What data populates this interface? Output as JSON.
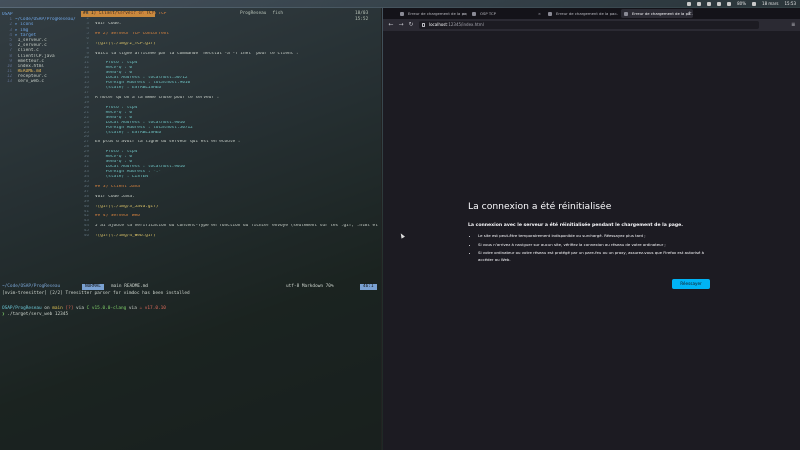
{
  "menubar": {
    "battery": "80%",
    "date": "18 mars",
    "time": "15:53"
  },
  "terminal": {
    "tree_header": "OSAP",
    "tree": [
      {
        "n": "1",
        "name": "~/Code/OSAP/ProgReseau/",
        "kind": "dir"
      },
      {
        "n": "2",
        "name": "▸ icons",
        "kind": "dir"
      },
      {
        "n": "3",
        "name": "▸ img",
        "kind": "dir"
      },
      {
        "n": "4",
        "name": "▸ target",
        "kind": "dir"
      },
      {
        "n": "5",
        "name": "  1_serveur.c",
        "kind": "file"
      },
      {
        "n": "6",
        "name": "  2_serveur.c",
        "kind": "file"
      },
      {
        "n": "7",
        "name": "  client.c",
        "kind": "file"
      },
      {
        "n": "8",
        "name": "  ClientTCP.java",
        "kind": "file"
      },
      {
        "n": "9",
        "name": "  emetteur.c",
        "kind": "file"
      },
      {
        "n": "10",
        "name": "  index.html",
        "kind": "file"
      },
      {
        "n": "11",
        "name": "  README.md",
        "kind": "mod"
      },
      {
        "n": "12",
        "name": "  recepteur.c",
        "kind": "file"
      },
      {
        "n": "13",
        "name": "  serv_web.c",
        "kind": "file"
      }
    ],
    "editor_tab": "## 1) Client/Serveur en TCP",
    "tab_rest": [
      "ProgReseau",
      "fish"
    ],
    "tab_clock": "18/03 15:52",
    "editor_lines": [
      {
        "n": "1",
        "t": "## 1) Client/Serveur en TCP",
        "c": "h"
      },
      {
        "n": "2",
        "t": "",
        "c": "plain"
      },
      {
        "n": "3",
        "t": "Voir Code.",
        "c": "plain"
      },
      {
        "n": "4",
        "t": "",
        "c": "plain"
      },
      {
        "n": "5",
        "t": "## 2) Serveur TCP Concurrent",
        "c": "h"
      },
      {
        "n": "6",
        "t": "",
        "c": "plain"
      },
      {
        "n": "7",
        "t": "![gif](./img/2_TCP.gif)",
        "c": "link"
      },
      {
        "n": "8",
        "t": "",
        "c": "plain"
      },
      {
        "n": "9",
        "t": "Voici la ligne affichée par la commande `netstat -a -f inet` pour le client :",
        "c": "plain"
      },
      {
        "n": "10",
        "t": "",
        "c": "plain"
      },
      {
        "n": "11",
        "t": "    Proto : tcp4",
        "c": "ip"
      },
      {
        "n": "12",
        "t": "    Recv-Q : 0",
        "c": "ip"
      },
      {
        "n": "13",
        "t": "    Send-Q : 0",
        "c": "ip"
      },
      {
        "n": "14",
        "t": "    Local Address : localhost.50712",
        "c": "ip"
      },
      {
        "n": "15",
        "t": "    Foreign Address : localhost.9010",
        "c": "ip"
      },
      {
        "n": "16",
        "t": "    (state) : ESTABLISHED",
        "c": "ip"
      },
      {
        "n": "17",
        "t": "",
        "c": "plain"
      },
      {
        "n": "18",
        "t": "À noter qu'on a la même chose pour le serveur :",
        "c": "plain"
      },
      {
        "n": "19",
        "t": "",
        "c": "plain"
      },
      {
        "n": "20",
        "t": "    Proto : tcp4",
        "c": "ip"
      },
      {
        "n": "21",
        "t": "    Recv-Q : 0",
        "c": "ip"
      },
      {
        "n": "22",
        "t": "    Send-Q : 0",
        "c": "ip"
      },
      {
        "n": "23",
        "t": "    Local Address : localhost.9010",
        "c": "ip"
      },
      {
        "n": "24",
        "t": "    Foreign Address : localhost.50712",
        "c": "ip"
      },
      {
        "n": "25",
        "t": "    (state) : ESTABLISHED",
        "c": "ip"
      },
      {
        "n": "26",
        "t": "",
        "c": "plain"
      },
      {
        "n": "27",
        "t": "En plus d'avoir la ligne du serveur qui est en écoute :",
        "c": "plain"
      },
      {
        "n": "28",
        "t": "",
        "c": "plain"
      },
      {
        "n": "29",
        "t": "    Proto : tcp4",
        "c": "ip"
      },
      {
        "n": "30",
        "t": "    Recv-Q : 0",
        "c": "ip"
      },
      {
        "n": "31",
        "t": "    Send-Q : 0",
        "c": "ip"
      },
      {
        "n": "32",
        "t": "    Local Address : localhost.9010",
        "c": "ip"
      },
      {
        "n": "33",
        "t": "    Foreign Address : *.*",
        "c": "ip"
      },
      {
        "n": "34",
        "t": "    (state) : LISTEN",
        "c": "ip"
      },
      {
        "n": "35",
        "t": "",
        "c": "plain"
      },
      {
        "n": "36",
        "t": "## 3) Client Java",
        "c": "h"
      },
      {
        "n": "37",
        "t": "",
        "c": "plain"
      },
      {
        "n": "38",
        "t": "Voir Code Java.",
        "c": "plain"
      },
      {
        "n": "39",
        "t": "",
        "c": "plain"
      },
      {
        "n": "40",
        "t": "![gif](./img/3_Java.gif)",
        "c": "link"
      },
      {
        "n": "41",
        "t": "",
        "c": "plain"
      },
      {
        "n": "42",
        "t": "## 4) Serveur Web",
        "c": "h"
      },
      {
        "n": "43",
        "t": "",
        "c": "plain"
      },
      {
        "n": "44",
        "t": "J'ai ajouté la vérification du Content-Type en fonction du fichier envoyé (seulement sur les .gif, .html et .ico).",
        "c": "plain"
      },
      {
        "n": "45",
        "t": "",
        "c": "plain"
      },
      {
        "n": "46",
        "t": "![gif](./img/4_Web.gif)",
        "c": "link"
      }
    ],
    "status": {
      "path": "~/Code/OSAP/ProgReseau",
      "mode": "NORMAL",
      "branch": "main  README.md",
      "right": "utf-8  Markdown  70%",
      "pos": "46:1"
    },
    "message": "[nvim-treesitter] [2/2] Treesitter parser for vimdoc has been installed",
    "shell": [
      {
        "parts": [
          {
            "t": "OSAP/ProgReseau",
            "c": "cyan"
          },
          {
            "t": " on ",
            "c": "plain"
          },
          {
            "t": " main ",
            "c": "yellow"
          },
          {
            "t": "[?]",
            "c": "red"
          },
          {
            "t": " via ",
            "c": "plain"
          },
          {
            "t": "C v15.0.0-clang",
            "c": "green"
          },
          {
            "t": " via ",
            "c": "plain"
          },
          {
            "t": "☕ v17.0.10",
            "c": "red"
          }
        ]
      },
      {
        "parts": [
          {
            "t": "❯ ",
            "c": "green"
          },
          {
            "t": "./target/serv_web 12345",
            "c": "plain"
          }
        ]
      }
    ]
  },
  "browser": {
    "tabs": [
      {
        "label": "Erreur de chargement de la page",
        "active": false
      },
      {
        "label": "OSP TCP",
        "active": false
      },
      {
        "label": "Erreur de chargement de la pa...",
        "active": false
      },
      {
        "label": "Erreur de chargement de la pa...",
        "active": true
      }
    ],
    "url_host": "localhost",
    "url_path": ":12345/index.html",
    "error": {
      "title": "La connexion a été réinitialisée",
      "lead": "La connexion avec le serveur a été réinitialisée pendant le chargement de la page.",
      "items": [
        "Le site est peut-être temporairement indisponible ou surchargé. Réessayez plus tard ;",
        "Si vous n’arrivez à naviguer sur aucun site, vérifiez la connexion au réseau de votre ordinateur ;",
        "Si votre ordinateur ou votre réseau est protégé par un pare-feu ou un proxy, assurez-vous que Firefox est autorisé à accéder au Web."
      ],
      "retry_label": "Réessayer"
    }
  },
  "colors": {
    "accent": "#00b3f4",
    "heading": "#e0863f",
    "mode_bg": "#7aa1d2"
  }
}
